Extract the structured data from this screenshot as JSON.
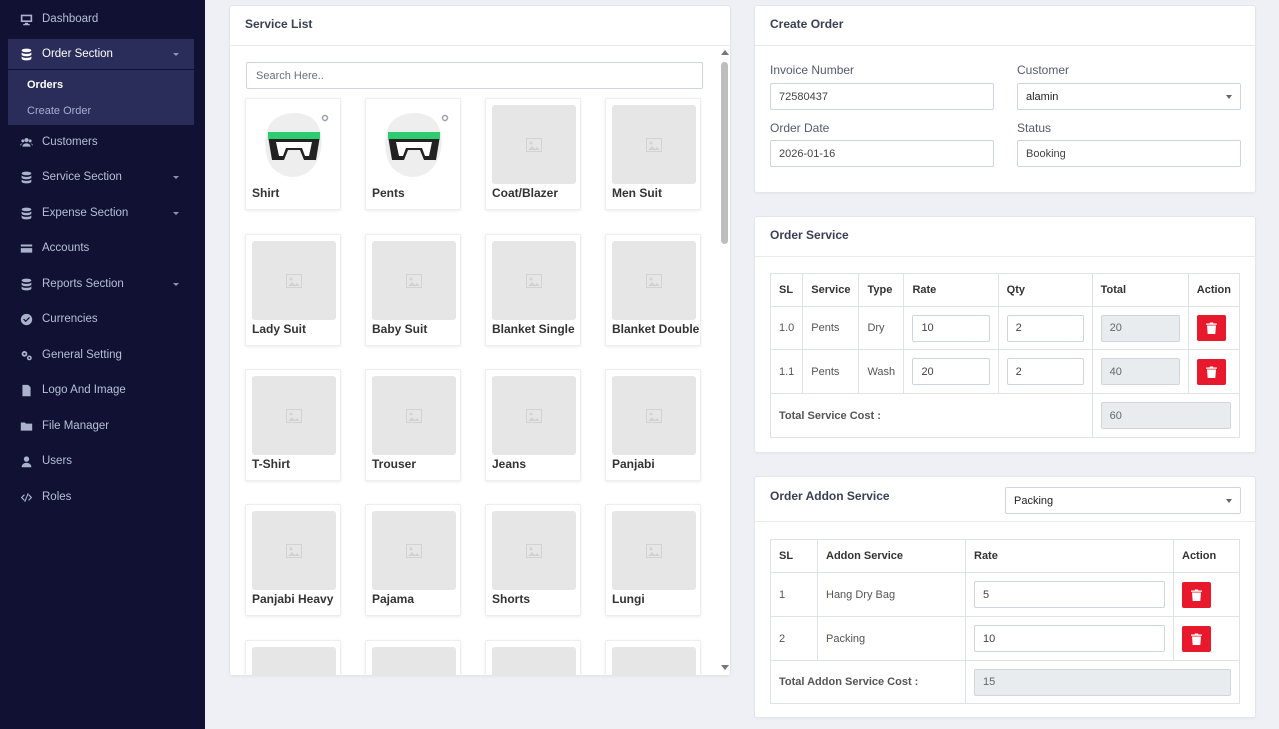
{
  "sidebar": {
    "items": [
      {
        "label": "Dashboard",
        "icon": "monitor-icon"
      },
      {
        "label": "Order Section",
        "icon": "database-icon",
        "expanded": true
      },
      {
        "label": "Customers",
        "icon": "users-icon"
      },
      {
        "label": "Service Section",
        "icon": "database-icon"
      },
      {
        "label": "Expense Section",
        "icon": "database-icon"
      },
      {
        "label": "Accounts",
        "icon": "credit-card-icon"
      },
      {
        "label": "Reports Section",
        "icon": "database-icon"
      },
      {
        "label": "Currencies",
        "icon": "check-circle-icon"
      },
      {
        "label": "General Setting",
        "icon": "gears-icon"
      },
      {
        "label": "Logo And Image",
        "icon": "file-icon"
      },
      {
        "label": "File Manager",
        "icon": "folder-icon"
      },
      {
        "label": "Users",
        "icon": "user-icon"
      },
      {
        "label": "Roles",
        "icon": "code-icon"
      }
    ],
    "sub_items": [
      {
        "label": "Orders",
        "current": true
      },
      {
        "label": "Create Order",
        "current": false
      }
    ]
  },
  "service_list": {
    "title": "Service List",
    "search_placeholder": "Search Here..",
    "services": [
      "Shirt",
      "Pents",
      "Coat/Blazer",
      "Men Suit",
      "Lady Suit",
      "Baby Suit",
      "Blanket Single",
      "Blanket Double",
      "T-Shirt",
      "Trouser",
      "Jeans",
      "Panjabi",
      "Panjabi Heavy",
      "Pajama",
      "Shorts",
      "Lungi",
      "",
      "",
      "",
      ""
    ]
  },
  "create_order": {
    "title": "Create Order",
    "invoice_label": "Invoice Number",
    "invoice_value": "72580437",
    "customer_label": "Customer",
    "customer_value": "alamin",
    "date_label": "Order Date",
    "date_value": "2026-01-16",
    "status_label": "Status",
    "status_value": "Booking"
  },
  "order_service": {
    "title": "Order Service",
    "headers": [
      "SL",
      "Service",
      "Type",
      "Rate",
      "Qty",
      "Total",
      "Action"
    ],
    "rows": [
      {
        "sl": "1.0",
        "service": "Pents",
        "type": "Dry",
        "rate": "10",
        "qty": "2",
        "total": "20"
      },
      {
        "sl": "1.1",
        "service": "Pents",
        "type": "Wash",
        "rate": "20",
        "qty": "2",
        "total": "40"
      }
    ],
    "total_label": "Total Service Cost :",
    "total_value": "60"
  },
  "addon": {
    "title": "Order Addon Service",
    "select_value": "Packing",
    "headers": [
      "SL",
      "Addon Service",
      "Rate",
      "Action"
    ],
    "rows": [
      {
        "sl": "1",
        "name": "Hang Dry Bag",
        "rate": "5"
      },
      {
        "sl": "2",
        "name": "Packing",
        "rate": "10"
      }
    ],
    "total_label": "Total Addon Service Cost :",
    "total_value": "15"
  },
  "colors": {
    "sidebar_bg": "#111233",
    "sidebar_active": "#2a2d5a",
    "danger": "#e8192c",
    "logo_green": "#2ecc71"
  }
}
